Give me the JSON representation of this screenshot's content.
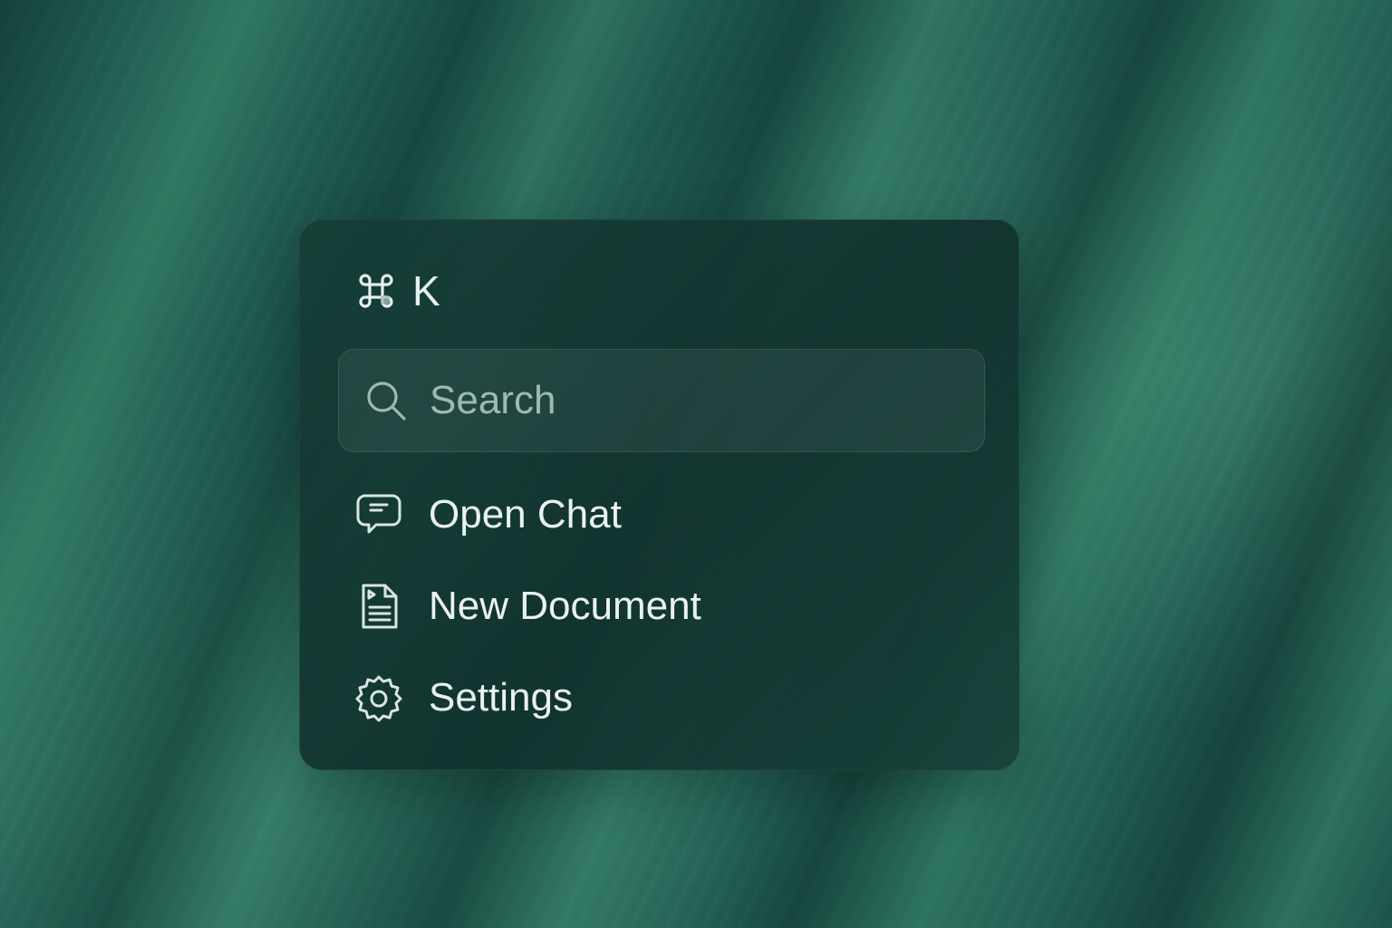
{
  "palette": {
    "shortcut": {
      "icon": "command-icon",
      "key": "K"
    },
    "search": {
      "icon": "search-icon",
      "placeholder": "Search",
      "value": ""
    },
    "items": [
      {
        "icon": "chat-bubble-icon",
        "label": "Open Chat"
      },
      {
        "icon": "document-icon",
        "label": "New Document"
      },
      {
        "icon": "gear-icon",
        "label": "Settings"
      }
    ]
  },
  "colors": {
    "background": "#225f54",
    "panel": "#163e38",
    "text": "#eaf3f0",
    "placeholder": "#9fb8b1"
  }
}
